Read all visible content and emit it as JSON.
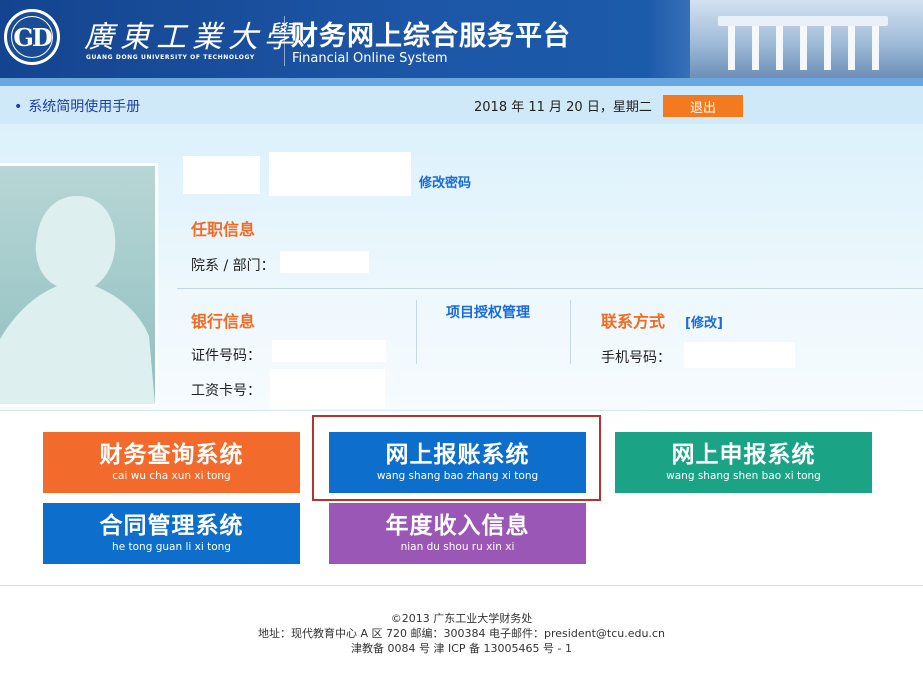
{
  "header": {
    "seal_text": "GD",
    "university_cn": "廣東工業大學",
    "university_en": "GUANG DONG UNIVERSITY OF TECHNOLOGY",
    "system_cn": "财务网上综合服务平台",
    "system_en": "Financial Online System"
  },
  "topbar": {
    "manual_link": "系统简明使用手册",
    "date": "2018 年 11 月 20 日，星期二",
    "logout": "退出"
  },
  "profile": {
    "change_password": "修改密码",
    "employment_title": "任职信息",
    "department_label": "院系 / 部门：",
    "bank_title": "银行信息",
    "id_label": "证件号码：",
    "salary_card_label": "工资卡号：",
    "project_auth": "项目授权管理",
    "contact_title": "联系方式",
    "contact_modify": "[修改]",
    "phone_label": "手机号码："
  },
  "systems": [
    {
      "cn": "财务查询系统",
      "pinyin": "cai wu cha xun xi tong",
      "color": "#f26a2c"
    },
    {
      "cn": "网上报账系统",
      "pinyin": "wang shang bao zhang xi tong",
      "color": "#0d6fcb"
    },
    {
      "cn": "网上申报系统",
      "pinyin": "wang shang shen bao xi tong",
      "color": "#1aa485"
    },
    {
      "cn": "合同管理系统",
      "pinyin": "he tong guan li xi tong",
      "color": "#0d6fcb"
    },
    {
      "cn": "年度收入信息",
      "pinyin": "nian du shou ru xin xi",
      "color": "#9b57b5"
    }
  ],
  "footer": {
    "line1": "©2013 广东工业大学财务处",
    "line2": "地址：现代教育中心 A 区 720 邮编：300384 电子邮件：president@tcu.edu.cn",
    "line3": "津教备 0084 号 津 ICP 备 13005465 号 - 1"
  }
}
